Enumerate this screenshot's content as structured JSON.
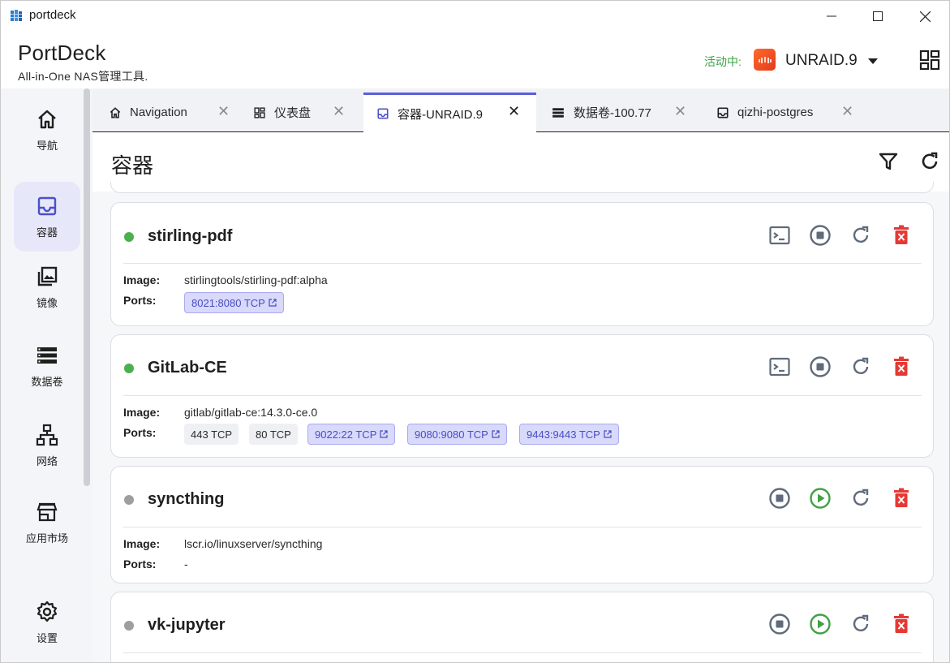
{
  "window": {
    "app_title": "portdeck"
  },
  "header": {
    "brand": "PortDeck",
    "tagline": "All-in-One NAS管理工具.",
    "active_label": "活动中:",
    "server_name": "UNRAID.9"
  },
  "sidebar": {
    "items": [
      {
        "label": "导航",
        "icon": "home-icon"
      },
      {
        "label": "容器",
        "icon": "inbox-icon"
      },
      {
        "label": "镜像",
        "icon": "images-icon"
      },
      {
        "label": "数据卷",
        "icon": "storage-icon"
      },
      {
        "label": "网络",
        "icon": "network-icon"
      },
      {
        "label": "应用市场",
        "icon": "store-icon"
      },
      {
        "label": "设置",
        "icon": "gear-icon"
      }
    ]
  },
  "tabs": [
    {
      "label": "Navigation",
      "icon": "home-icon"
    },
    {
      "label": "仪表盘",
      "icon": "dashboard-icon"
    },
    {
      "label": "容器-UNRAID.9",
      "icon": "inbox-icon",
      "active": true
    },
    {
      "label": "数据卷-100.77",
      "icon": "storage-icon"
    },
    {
      "label": "qizhi-postgres",
      "icon": "inbox-icon"
    }
  ],
  "page": {
    "title": "容器"
  },
  "labels": {
    "image": "Image:",
    "ports": "Ports:"
  },
  "containers": [
    {
      "name": "stirling-pdf",
      "status": "running",
      "image": "stirlingtools/stirling-pdf:alpha",
      "ports": [
        {
          "text": "8021:8080 TCP",
          "link": true
        }
      ]
    },
    {
      "name": "GitLab-CE",
      "status": "running",
      "image": "gitlab/gitlab-ce:14.3.0-ce.0",
      "ports": [
        {
          "text": "443 TCP",
          "link": false
        },
        {
          "text": "80 TCP",
          "link": false
        },
        {
          "text": "9022:22 TCP",
          "link": true
        },
        {
          "text": "9080:9080 TCP",
          "link": true
        },
        {
          "text": "9443:9443 TCP",
          "link": true
        }
      ]
    },
    {
      "name": "syncthing",
      "status": "stopped",
      "image": "lscr.io/linuxserver/syncthing",
      "ports_text": "-"
    },
    {
      "name": "vk-jupyter",
      "status": "stopped"
    }
  ],
  "colors": {
    "accent": "#5b5fd6",
    "running": "#4caf50",
    "stopped": "#9e9e9e",
    "danger": "#e53935",
    "active_green": "#3aa243"
  }
}
